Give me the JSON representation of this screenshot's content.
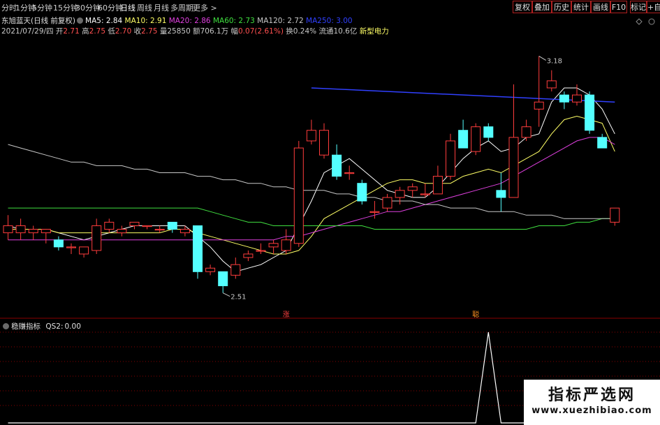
{
  "toolbar": {
    "periods": [
      "分时",
      "1分钟",
      "5分钟",
      "15分钟",
      "30分钟",
      "60分钟",
      "日线",
      "周线",
      "月线",
      "多周期",
      "更多 >"
    ],
    "active_period": "日线",
    "right_buttons": [
      "复权",
      "叠加",
      "历史",
      "统计",
      "画线",
      "F10",
      "标记",
      "+自"
    ]
  },
  "stock": {
    "title": "东旭蓝天(日线 前复权)",
    "ma_labels": [
      {
        "text": "MA5: 2.84",
        "color": "#ffffff"
      },
      {
        "text": "MA10: 2.91",
        "color": "#ffff66"
      },
      {
        "text": "MA20: 2.86",
        "color": "#e040e0"
      },
      {
        "text": "MA60: 2.73",
        "color": "#40e040"
      },
      {
        "text": "MA120: 2.72",
        "color": "#c8c8c8"
      },
      {
        "text": "MA250: 3.00",
        "color": "#3040ff"
      }
    ],
    "info": [
      {
        "text": "2021/07/29/四",
        "color": "#c8c8c8"
      },
      {
        "text": " 开",
        "color": "#c8c8c8"
      },
      {
        "text": "2.71",
        "color": "#ff5050"
      },
      {
        "text": " 高",
        "color": "#c8c8c8"
      },
      {
        "text": "2.75",
        "color": "#ff5050"
      },
      {
        "text": " 低",
        "color": "#c8c8c8"
      },
      {
        "text": "2.70",
        "color": "#ff5050"
      },
      {
        "text": " 收",
        "color": "#c8c8c8"
      },
      {
        "text": "2.75",
        "color": "#ff5050"
      },
      {
        "text": " 量",
        "color": "#c8c8c8"
      },
      {
        "text": "25850",
        "color": "#c8c8c8"
      },
      {
        "text": " 额",
        "color": "#c8c8c8"
      },
      {
        "text": "706.1万",
        "color": "#c8c8c8"
      },
      {
        "text": " 幅",
        "color": "#c8c8c8"
      },
      {
        "text": "0.07(2.61%)",
        "color": "#ff5050"
      },
      {
        "text": " 换",
        "color": "#c8c8c8"
      },
      {
        "text": "0.24%",
        "color": "#c8c8c8"
      },
      {
        "text": " 流通",
        "color": "#c8c8c8"
      },
      {
        "text": "10.6亿",
        "color": "#c8c8c8"
      },
      {
        "text": "  新型电力",
        "color": "#ffff66"
      }
    ]
  },
  "chart_data": [
    {
      "type": "candlestick",
      "title": "东旭蓝天(日线 前复权)",
      "x": [
        "d1",
        "d2",
        "d3",
        "d4",
        "d5",
        "d6",
        "d7",
        "d8",
        "d9",
        "d10",
        "d11",
        "d12",
        "d13",
        "d14",
        "d15",
        "d16",
        "d17",
        "d18",
        "d19",
        "d20",
        "d21",
        "d22",
        "d23",
        "d24",
        "d25",
        "d26",
        "d27",
        "d28",
        "d29",
        "d30",
        "d31",
        "d32",
        "d33",
        "d34",
        "d35",
        "d36",
        "d37",
        "d38",
        "d39",
        "d40",
        "d41",
        "d42",
        "d43",
        "d44",
        "d45",
        "d46",
        "d47",
        "d48",
        "d49"
      ],
      "ohlc": [
        [
          2.68,
          2.73,
          2.66,
          2.7
        ],
        [
          2.68,
          2.72,
          2.66,
          2.7
        ],
        [
          2.68,
          2.7,
          2.66,
          2.69
        ],
        [
          2.68,
          2.69,
          2.65,
          2.69
        ],
        [
          2.66,
          2.67,
          2.63,
          2.64
        ],
        [
          2.64,
          2.65,
          2.62,
          2.64
        ],
        [
          2.62,
          2.64,
          2.61,
          2.64
        ],
        [
          2.63,
          2.72,
          2.62,
          2.7
        ],
        [
          2.69,
          2.72,
          2.68,
          2.71
        ],
        [
          2.68,
          2.7,
          2.67,
          2.69
        ],
        [
          2.7,
          2.71,
          2.69,
          2.71
        ],
        [
          2.7,
          2.7,
          2.69,
          2.7
        ],
        [
          2.69,
          2.7,
          2.68,
          2.69
        ],
        [
          2.71,
          2.71,
          2.68,
          2.69
        ],
        [
          2.68,
          2.7,
          2.67,
          2.69
        ],
        [
          2.7,
          2.7,
          2.55,
          2.57
        ],
        [
          2.57,
          2.59,
          2.56,
          2.58
        ],
        [
          2.57,
          2.57,
          2.51,
          2.53
        ],
        [
          2.56,
          2.61,
          2.55,
          2.59
        ],
        [
          2.61,
          2.63,
          2.6,
          2.62
        ],
        [
          2.63,
          2.65,
          2.62,
          2.63
        ],
        [
          2.64,
          2.66,
          2.62,
          2.65
        ],
        [
          2.63,
          2.69,
          2.62,
          2.66
        ],
        [
          2.65,
          2.94,
          2.64,
          2.92
        ],
        [
          2.94,
          3.0,
          2.93,
          2.97
        ],
        [
          2.9,
          2.99,
          2.89,
          2.97
        ],
        [
          2.9,
          2.93,
          2.83,
          2.84
        ],
        [
          2.85,
          2.87,
          2.83,
          2.85
        ],
        [
          2.82,
          2.83,
          2.76,
          2.77
        ],
        [
          2.74,
          2.77,
          2.72,
          2.74
        ],
        [
          2.75,
          2.79,
          2.74,
          2.78
        ],
        [
          2.78,
          2.81,
          2.76,
          2.8
        ],
        [
          2.8,
          2.82,
          2.78,
          2.81
        ],
        [
          2.79,
          2.82,
          2.78,
          2.79
        ],
        [
          2.79,
          2.87,
          2.79,
          2.84
        ],
        [
          2.84,
          2.96,
          2.83,
          2.94
        ],
        [
          2.97,
          3.0,
          2.94,
          2.92
        ],
        [
          2.91,
          2.99,
          2.9,
          2.98
        ],
        [
          2.98,
          2.99,
          2.94,
          2.95
        ],
        [
          2.8,
          2.85,
          2.74,
          2.78
        ],
        [
          2.78,
          3.1,
          2.78,
          2.95
        ],
        [
          2.95,
          3.0,
          2.94,
          2.98
        ],
        [
          3.03,
          3.18,
          2.98,
          3.05
        ],
        [
          3.09,
          3.14,
          3.08,
          3.11
        ],
        [
          3.07,
          3.08,
          3.03,
          3.05
        ],
        [
          3.05,
          3.1,
          3.04,
          3.07
        ],
        [
          3.07,
          3.08,
          2.96,
          2.97
        ],
        [
          2.95,
          2.96,
          2.93,
          2.92
        ],
        [
          2.71,
          2.75,
          2.7,
          2.75
        ]
      ],
      "markers": [
        {
          "label": "3.18"
        },
        {
          "label": "2.51"
        }
      ],
      "signals": [
        "涨",
        "聪"
      ],
      "series": [
        {
          "name": "MA5",
          "color": "#ffffff",
          "values": [
            2.7,
            2.69,
            2.69,
            2.69,
            2.68,
            2.67,
            2.66,
            2.67,
            2.68,
            2.69,
            2.7,
            2.7,
            2.7,
            2.7,
            2.7,
            2.67,
            2.64,
            2.6,
            2.57,
            2.58,
            2.59,
            2.61,
            2.63,
            2.7,
            2.77,
            2.85,
            2.87,
            2.89,
            2.86,
            2.83,
            2.8,
            2.79,
            2.78,
            2.78,
            2.81,
            2.85,
            2.89,
            2.92,
            2.94,
            2.91,
            2.92,
            2.95,
            2.96,
            3.05,
            3.09,
            3.09,
            3.07,
            3.03,
            2.96
          ]
        },
        {
          "name": "MA10",
          "color": "#ffff66",
          "values": [
            2.69,
            2.69,
            2.69,
            2.69,
            2.68,
            2.68,
            2.68,
            2.68,
            2.68,
            2.68,
            2.68,
            2.68,
            2.68,
            2.69,
            2.69,
            2.68,
            2.67,
            2.66,
            2.65,
            2.64,
            2.63,
            2.62,
            2.62,
            2.63,
            2.67,
            2.72,
            2.74,
            2.76,
            2.78,
            2.8,
            2.82,
            2.83,
            2.83,
            2.82,
            2.82,
            2.82,
            2.84,
            2.85,
            2.86,
            2.85,
            2.87,
            2.89,
            2.91,
            2.96,
            3.0,
            3.01,
            3.0,
            2.99,
            2.91
          ]
        },
        {
          "name": "MA20",
          "color": "#e040e0",
          "values": [
            2.66,
            2.66,
            2.66,
            2.66,
            2.66,
            2.66,
            2.66,
            2.66,
            2.66,
            2.66,
            2.66,
            2.66,
            2.66,
            2.66,
            2.66,
            2.66,
            2.66,
            2.66,
            2.66,
            2.66,
            2.66,
            2.66,
            2.67,
            2.67,
            2.68,
            2.69,
            2.7,
            2.71,
            2.72,
            2.73,
            2.74,
            2.74,
            2.75,
            2.76,
            2.77,
            2.78,
            2.79,
            2.8,
            2.81,
            2.82,
            2.84,
            2.86,
            2.88,
            2.9,
            2.92,
            2.94,
            2.95,
            2.95,
            2.93
          ]
        },
        {
          "name": "MA60",
          "color": "#40e040",
          "values": [
            2.75,
            2.75,
            2.75,
            2.75,
            2.75,
            2.75,
            2.75,
            2.75,
            2.75,
            2.75,
            2.75,
            2.75,
            2.75,
            2.75,
            2.75,
            2.75,
            2.74,
            2.73,
            2.72,
            2.71,
            2.71,
            2.7,
            2.7,
            2.7,
            2.7,
            2.7,
            2.7,
            2.7,
            2.7,
            2.69,
            2.69,
            2.69,
            2.69,
            2.69,
            2.69,
            2.69,
            2.69,
            2.69,
            2.69,
            2.69,
            2.69,
            2.69,
            2.7,
            2.7,
            2.7,
            2.71,
            2.71,
            2.72,
            2.72
          ]
        },
        {
          "name": "MA120",
          "color": "#c8c8c8",
          "values": [
            2.93,
            2.92,
            2.91,
            2.9,
            2.89,
            2.88,
            2.88,
            2.87,
            2.87,
            2.87,
            2.86,
            2.86,
            2.85,
            2.85,
            2.85,
            2.84,
            2.84,
            2.83,
            2.83,
            2.82,
            2.82,
            2.81,
            2.81,
            2.8,
            2.8,
            2.8,
            2.79,
            2.79,
            2.78,
            2.78,
            2.77,
            2.77,
            2.77,
            2.76,
            2.76,
            2.75,
            2.75,
            2.75,
            2.74,
            2.74,
            2.74,
            2.73,
            2.73,
            2.73,
            2.72,
            2.72,
            2.72,
            2.72,
            2.72
          ]
        },
        {
          "name": "MA250",
          "color": "#3040ff",
          "points": [
            [
              24,
              3.09
            ],
            [
              48,
              3.05
            ]
          ]
        }
      ],
      "ylim": [
        2.46,
        3.24
      ]
    },
    {
      "type": "line",
      "title": "稳赚指标 QS2: 0.00",
      "series": [
        {
          "name": "QS2",
          "values": [
            0,
            0,
            0,
            0,
            0,
            0,
            0,
            0,
            0,
            0,
            0,
            0,
            0,
            0,
            0,
            0,
            0,
            0,
            0,
            0,
            0,
            0,
            0,
            0,
            0,
            0,
            0,
            0,
            0,
            0,
            0,
            0,
            0,
            0,
            0,
            0,
            0,
            0,
            1,
            0,
            0,
            0,
            0,
            0,
            0,
            0,
            0,
            0,
            0
          ]
        }
      ],
      "ylim": [
        0,
        1
      ]
    }
  ],
  "indicator": {
    "title": "稳赚指标",
    "qs2_label": "QS2:",
    "qs2_value": "0.00"
  },
  "watermark": {
    "cn": "指标严选网",
    "en": "www.xuezhibiao.com"
  },
  "colors": {
    "up": "#ff3c3c",
    "down": "#54ffff",
    "background": "#000000",
    "grid": "#8a0000"
  }
}
